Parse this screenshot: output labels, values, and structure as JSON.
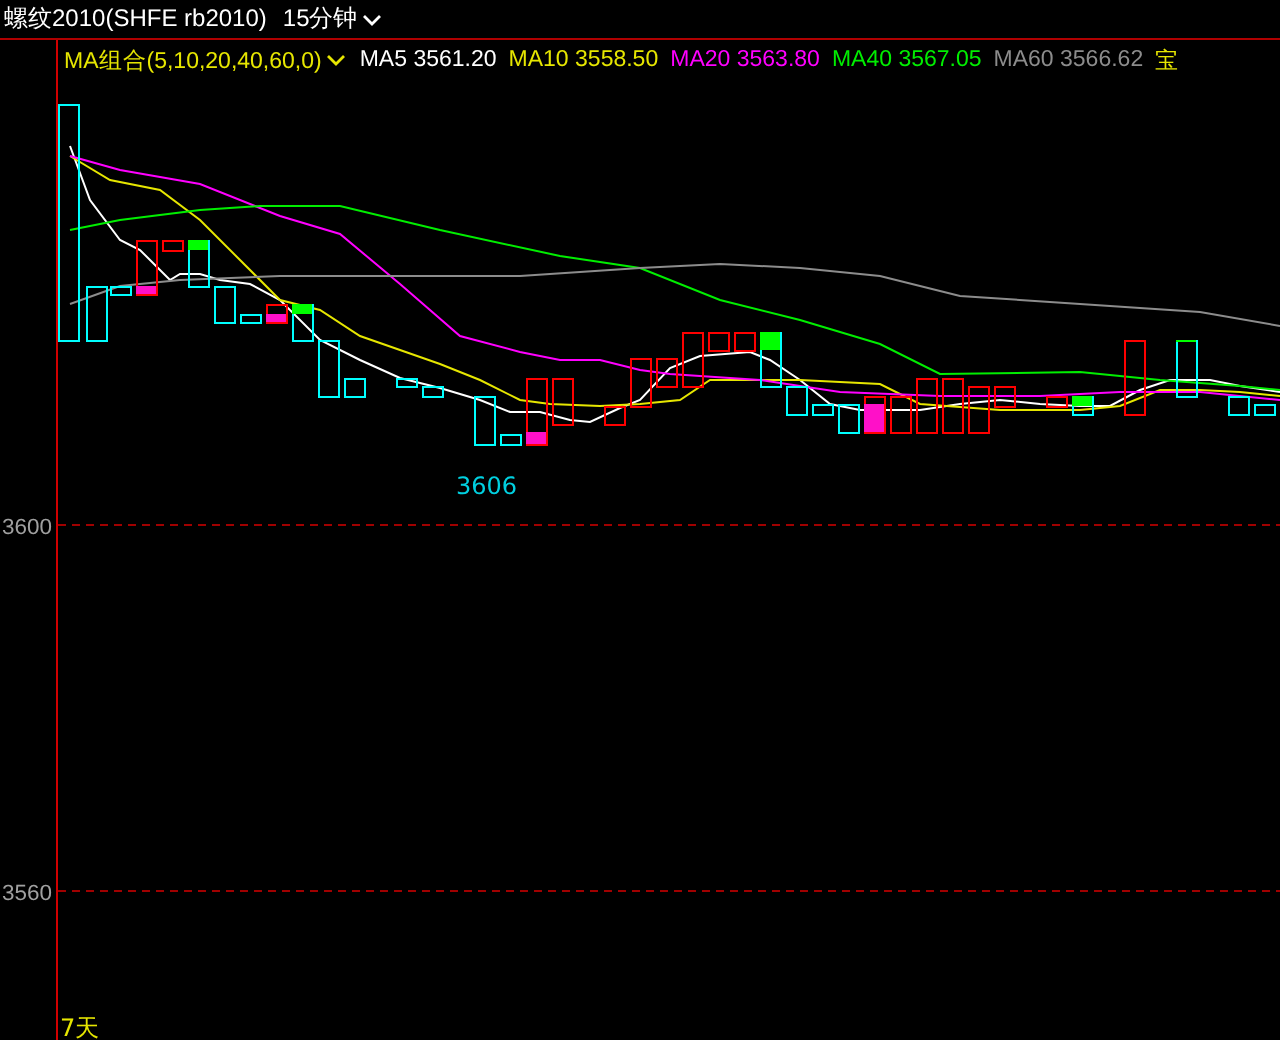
{
  "header": {
    "title": "螺纹2010(SHFE rb2010)",
    "period": "15分钟"
  },
  "legend": {
    "indicator": "MA组合(5,10,20,40,60,0)",
    "items": [
      {
        "label": "MA5",
        "value": "3561.20",
        "color": "#ffffff"
      },
      {
        "label": "MA10",
        "value": "3558.50",
        "color": "#e6e600"
      },
      {
        "label": "MA20",
        "value": "3563.80",
        "color": "#ff00ff"
      },
      {
        "label": "MA40",
        "value": "3567.05",
        "color": "#00ee00"
      },
      {
        "label": "MA60",
        "value": "3566.62",
        "color": "#8c8c8c"
      }
    ],
    "trailing": "宝"
  },
  "chart": {
    "y_ticks": [
      "3600",
      "3560"
    ],
    "low_marker": "3606",
    "range_label": "7天"
  }
}
